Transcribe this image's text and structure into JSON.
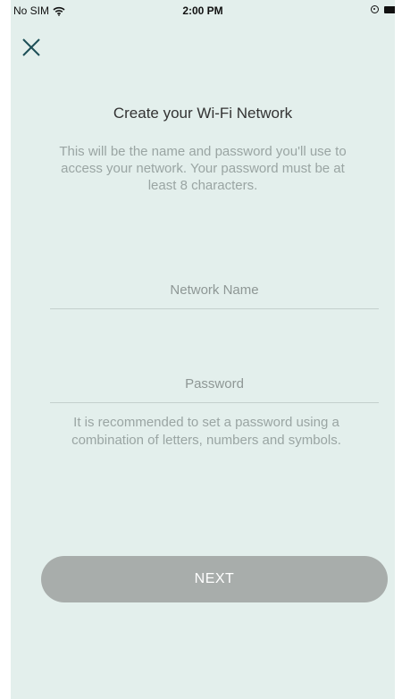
{
  "status_bar": {
    "carrier": "No SIM",
    "time": "2:00 PM",
    "icons": [
      "wifi-icon",
      "orientation-lock-icon",
      "battery-icon"
    ]
  },
  "header": {
    "close_icon": "close-icon"
  },
  "main": {
    "title": "Create your Wi-Fi Network",
    "description": "This will be the name and password you'll use to access your network. Your password must be at least 8 characters.",
    "network_name": {
      "value": "",
      "placeholder": "Network Name"
    },
    "password": {
      "value": "",
      "placeholder": "Password"
    },
    "hint": "It is recommended to set a password using a combination of letters, numbers and symbols.",
    "next_label": "NEXT"
  },
  "colors": {
    "background": "#e3efec",
    "button_disabled": "#a8adab",
    "muted_text": "#9aa5a3"
  }
}
